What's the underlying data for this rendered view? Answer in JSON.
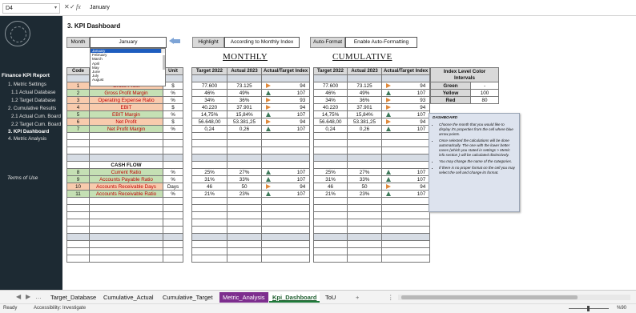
{
  "formula_bar": {
    "cell_ref": "D4",
    "value": "January",
    "fx": "fx",
    "x": "✕",
    "check": "✓"
  },
  "sidebar": {
    "title": "Finance KPI Report",
    "items": [
      "1. Metric Settings",
      "1.1 Actual Database",
      "1.2 Target Database",
      "2. Cumulative Results",
      "2.1 Actual Cum. Board",
      "2.2 Target Cum. Board",
      "3. KPI Dashboard",
      "4. Metric Analysis"
    ],
    "active_index": 6,
    "terms": "Terms of Use"
  },
  "sheet": {
    "title": "3. KPI Dashboard",
    "month_label": "Month",
    "month_value": "January",
    "highlight_label": "Highlight",
    "highlight_value": "According to Monthly Index",
    "autoformat_label": "Auto-Format",
    "autoformat_value": "Enable Auto-Formatting",
    "dropdown_options": [
      "January",
      "February",
      "March",
      "April",
      "May",
      "June",
      "July",
      "August"
    ],
    "monthly_title": "MONTHLY",
    "cumulative_title": "CUMULATIVE",
    "left_headers": {
      "code": "Code",
      "unit": "Unit"
    },
    "monthly_headers": [
      "Target 2022",
      "Actual 2023",
      "Actual/Target Index"
    ],
    "cumulative_headers": [
      "Target 2022",
      "Actual 2023",
      "Actual/Target Index"
    ],
    "cashflow_label": "CASH FLOW",
    "rows": [
      {
        "code": "1",
        "name": "Gross Profit",
        "unit": "$",
        "t": "77.600",
        "a": "73.125",
        "dir": "right",
        "idx": "94",
        "ct": "77.600",
        "ca": "73.125",
        "cdir": "right",
        "cidx": "94",
        "color": "o"
      },
      {
        "code": "2",
        "name": "Gross Profit Margin",
        "unit": "%",
        "t": "46%",
        "a": "49%",
        "dir": "up",
        "idx": "107",
        "ct": "46%",
        "ca": "49%",
        "cdir": "up",
        "cidx": "107",
        "color": "g"
      },
      {
        "code": "3",
        "name": "Operating Expense Ratio",
        "unit": "%",
        "t": "34%",
        "a": "36%",
        "dir": "right",
        "idx": "93",
        "ct": "34%",
        "ca": "36%",
        "cdir": "right",
        "cidx": "93",
        "color": "o"
      },
      {
        "code": "4",
        "name": "EBIT",
        "unit": "$",
        "t": "40.220",
        "a": "37.901",
        "dir": "right",
        "idx": "94",
        "ct": "40.220",
        "ca": "37.901",
        "cdir": "right",
        "cidx": "94",
        "color": "o"
      },
      {
        "code": "5",
        "name": "EBIT Margin",
        "unit": "%",
        "t": "14,75%",
        "a": "15,84%",
        "dir": "up",
        "idx": "107",
        "ct": "14,75%",
        "ca": "15,84%",
        "cdir": "up",
        "cidx": "107",
        "color": "g"
      },
      {
        "code": "6",
        "name": "Net Profit",
        "unit": "$",
        "t": "56.648,00",
        "a": "53.381,25",
        "dir": "right",
        "idx": "94",
        "ct": "56.648,00",
        "ca": "53.381,25",
        "cdir": "right",
        "cidx": "94",
        "color": "o"
      },
      {
        "code": "7",
        "name": "Net Profit Margin",
        "unit": "%",
        "t": "0,24",
        "a": "0,26",
        "dir": "up",
        "idx": "107",
        "ct": "0,24",
        "ca": "0,26",
        "cdir": "up",
        "cidx": "107",
        "color": "g"
      }
    ],
    "cash_rows": [
      {
        "code": "8",
        "name": "Current Ratio",
        "unit": "%",
        "t": "25%",
        "a": "27%",
        "dir": "up",
        "idx": "107",
        "ct": "25%",
        "ca": "27%",
        "cdir": "up",
        "cidx": "107",
        "color": "g"
      },
      {
        "code": "9",
        "name": "Accounts Payable Ratio",
        "unit": "%",
        "t": "31%",
        "a": "33%",
        "dir": "up",
        "idx": "107",
        "ct": "31%",
        "ca": "33%",
        "cdir": "up",
        "cidx": "107",
        "color": "g"
      },
      {
        "code": "10",
        "name": "Accounts Receivable Days",
        "unit": "Days",
        "t": "46",
        "a": "50",
        "dir": "right",
        "idx": "94",
        "ct": "46",
        "ca": "50",
        "cdir": "right",
        "cidx": "94",
        "color": "o"
      },
      {
        "code": "11",
        "name": "Accounts Receivable Ratio",
        "unit": "%",
        "t": "21%",
        "a": "23%",
        "dir": "up",
        "idx": "107",
        "ct": "21%",
        "ca": "23%",
        "cdir": "up",
        "cidx": "107",
        "color": "g"
      }
    ],
    "legend": {
      "title": "Index Level Color Intervals",
      "rows": [
        {
          "label": "Green",
          "value": "-"
        },
        {
          "label": "Yellow",
          "value": "100"
        },
        {
          "label": "Red",
          "value": "80"
        }
      ]
    },
    "note": {
      "title": "DASHBOARD",
      "items": [
        "Choose the month that you would like to display it's properties from the cell where blue arrow points.",
        "Once selected the calculations will be done automatically. The one with the lower better cases (which you stated in settings > Metric info section ) will be calculated distinctively.",
        "You may change the name of the categories.",
        "If there is no proper format on the cell you may select the cell and change its format."
      ]
    }
  },
  "tabs": {
    "nav": [
      "◀",
      "▶",
      "…"
    ],
    "items": [
      "Target_Database",
      "Cumulative_Actual",
      "Cumulative_Target",
      "Metric_Analysis",
      "Kpi_Dashboard",
      "ToU"
    ],
    "active": "Kpi_Dashboard",
    "add": "+",
    "more": "⋮"
  },
  "status": {
    "ready": "Ready",
    "accessibility": "Accessibility: Investigate",
    "zoom": "%90"
  },
  "colors": {
    "sidebar": "#1d2a33",
    "green_fill": "#c5e0b4",
    "orange_fill": "#f8cbad",
    "up_arrow": "#3e7a5a",
    "right_arrow": "#e08a3c",
    "note_bg": "#dde3ee"
  }
}
